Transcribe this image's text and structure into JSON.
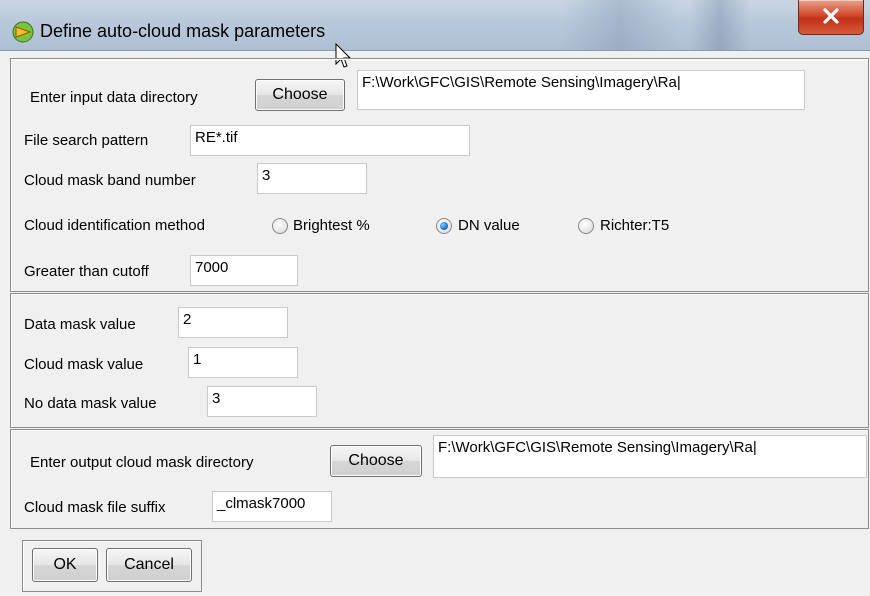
{
  "window": {
    "title": "Define auto-cloud mask parameters",
    "close_label": "X"
  },
  "input_section": {
    "dir_label": "Enter input data directory",
    "choose_label": "Choose",
    "dir_value": "F:\\Work\\GFC\\GIS\\Remote Sensing\\Imagery\\Ra|",
    "pattern_label": "File search pattern",
    "pattern_value": "RE*.tif",
    "band_label": "Cloud mask band number",
    "band_value": "3",
    "method_label": "Cloud identification method",
    "methods": [
      {
        "label": "Brightest %",
        "checked": false
      },
      {
        "label": "DN value",
        "checked": true
      },
      {
        "label": "Richter:T5",
        "checked": false
      }
    ],
    "cutoff_label": "Greater than cutoff",
    "cutoff_value": "7000"
  },
  "mask_section": {
    "data_label": "Data mask value",
    "data_value": "2",
    "cloud_label": "Cloud mask value",
    "cloud_value": "1",
    "nodata_label": "No data mask value",
    "nodata_value": "3"
  },
  "output_section": {
    "dir_label": "Enter output cloud mask directory",
    "choose_label": "Choose",
    "dir_value": "F:\\Work\\GFC\\GIS\\Remote Sensing\\Imagery\\Ra|",
    "suffix_label": "Cloud mask file suffix",
    "suffix_value": "_clmask7000"
  },
  "actions": {
    "ok_label": "OK",
    "cancel_label": "Cancel"
  },
  "colors": {
    "titlebar": "#b9c9db",
    "close_button": "#c0301a",
    "radio_selected": "#1b74d1",
    "background": "#f0f0f0"
  }
}
